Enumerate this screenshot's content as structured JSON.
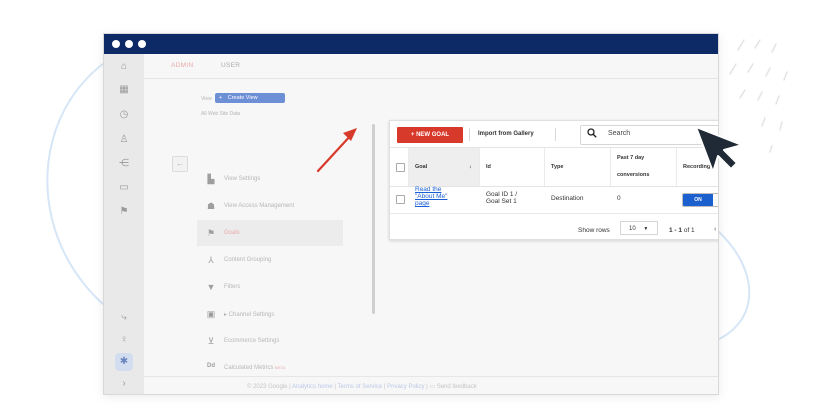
{
  "colors": {
    "titlebar": "#0d2a66",
    "new_goal_button": "#d7392b",
    "toggle_on": "#1c5fce",
    "link": "#1a5fd6",
    "annotation_arrow": "#d7392b"
  },
  "tabs": [
    {
      "label": "ADMIN",
      "active": true
    },
    {
      "label": "USER",
      "active": false
    }
  ],
  "view": {
    "label": "View",
    "create_button": "Create View",
    "subtitle": "All Web Site Data"
  },
  "rail_icons": [
    "home-icon",
    "dashboard-icon",
    "clock-icon",
    "person-icon",
    "acquisition-icon",
    "behavior-icon",
    "flag-icon",
    "route-icon",
    "lightbulb-icon",
    "gear-icon",
    "expand-icon"
  ],
  "admin_menu": [
    {
      "label": "View Settings",
      "icon": "document-icon",
      "selected": false
    },
    {
      "label": "View Access Management",
      "icon": "users-icon",
      "selected": false
    },
    {
      "label": "Goals",
      "icon": "flag-icon",
      "selected": true
    },
    {
      "label": "Content Grouping",
      "icon": "grouping-icon",
      "selected": false
    },
    {
      "label": "Filters",
      "icon": "filter-icon",
      "selected": false
    },
    {
      "label": "Channel Settings",
      "icon": "channel-icon",
      "selected": false
    },
    {
      "label": "Ecommerce Settings",
      "icon": "cart-icon",
      "selected": false
    },
    {
      "label": "Calculated Metrics",
      "icon": "metrics-icon",
      "selected": false,
      "badge": "BETA"
    }
  ],
  "goals_panel": {
    "new_goal_label": "+ NEW GOAL",
    "import_label": "Import from Gallery",
    "search_placeholder": "Search",
    "columns": [
      "Goal",
      "Id",
      "Type",
      "Past 7 day conversions",
      "Recording"
    ],
    "column_past7_line1": "Past 7 day",
    "column_past7_line2": "conversions",
    "sort_indicator": "↓",
    "rows": [
      {
        "goal_line1": "Read the",
        "goal_line2": "\"About Me\"",
        "goal_line3": "page",
        "id_line1": "Goal ID 1 /",
        "id_line2": "Goal Set 1",
        "type": "Destination",
        "conversions": "0",
        "recording": "ON"
      }
    ],
    "pagination": {
      "show_rows_label": "Show rows",
      "rows_value": "10",
      "range_bold": "1 - 1",
      "range_rest": "of 1",
      "prev": "‹",
      "next": "›"
    }
  },
  "footer": {
    "copyright": "© 2023 Google",
    "sep": "|",
    "analytics_home": "Analytics home",
    "terms": "Terms of Service",
    "privacy": "Privacy Policy",
    "feedback": "Send feedback"
  }
}
